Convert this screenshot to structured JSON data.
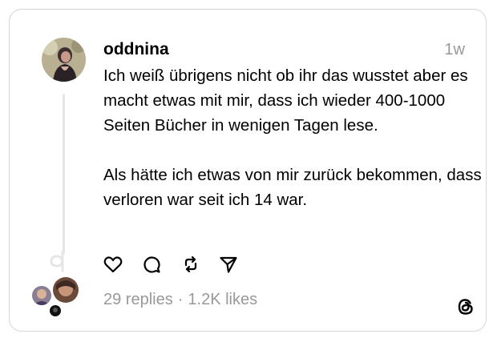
{
  "post": {
    "username": "oddnina",
    "time_ago": "1w",
    "paragraphs": [
      "Ich weiß übrigens nicht ob ihr das wusstet aber es macht etwas mit mir, dass ich wieder 400-1000 Seiten Bücher in wenigen Tagen lese.",
      "Als hätte ich etwas von mir zurück bekommen, dass verloren war seit ich 14 war."
    ],
    "replies": "29 replies",
    "separator": "·",
    "likes": "1.2K likes"
  },
  "icons": {
    "like": "heart-icon",
    "comment": "comment-icon",
    "repost": "repost-icon",
    "share": "share-icon",
    "brand": "threads-logo-icon"
  },
  "colors": {
    "text": "#000000",
    "muted": "#999999",
    "border": "#d6d6d6",
    "thread_line": "#e6e6e6"
  }
}
